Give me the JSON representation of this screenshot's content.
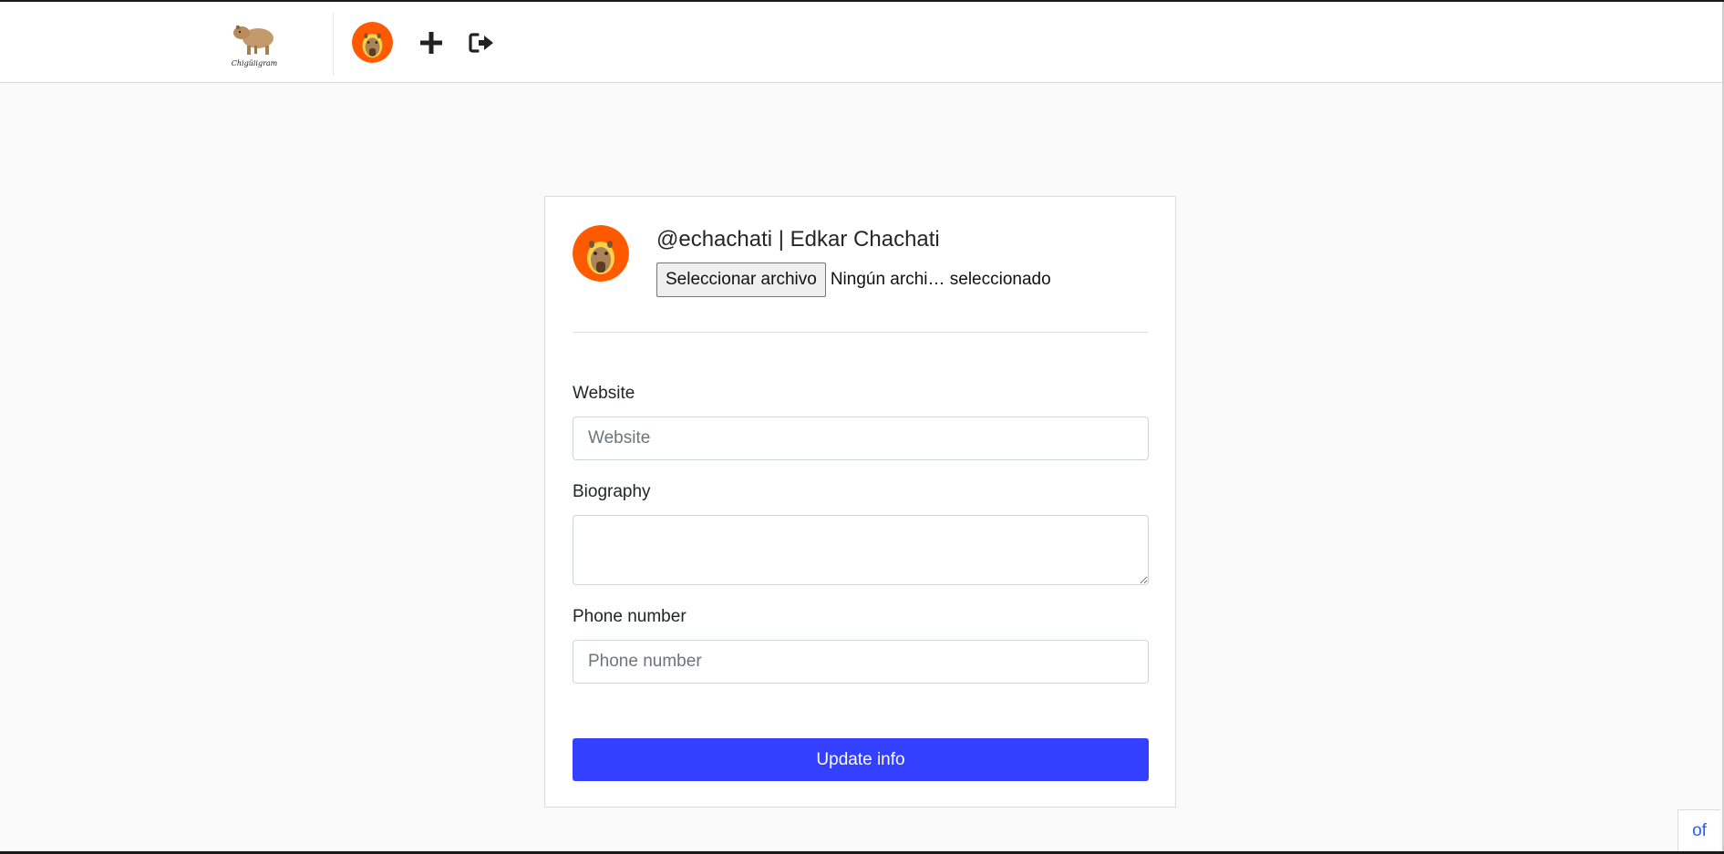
{
  "header": {
    "logo_text": "Chigüiigram"
  },
  "profile": {
    "title": "@echachati | Edkar Chachati",
    "file_button_label": "Seleccionar archivo",
    "file_status": "Ningún archi… seleccionado"
  },
  "form": {
    "website": {
      "label": "Website",
      "placeholder": "Website",
      "value": ""
    },
    "biography": {
      "label": "Biography",
      "value": ""
    },
    "phone": {
      "label": "Phone number",
      "placeholder": "Phone number",
      "value": ""
    },
    "submit_label": "Update info"
  },
  "corner_tab": {
    "label": "of"
  },
  "colors": {
    "primary_button": "#3340ff",
    "background": "#fafafa",
    "avatar_orange": "#ff5a00",
    "avatar_yellow": "#ffc61a"
  },
  "icons": {
    "add": "plus-icon",
    "logout": "sign-out-icon",
    "logo": "capybara-logo"
  }
}
